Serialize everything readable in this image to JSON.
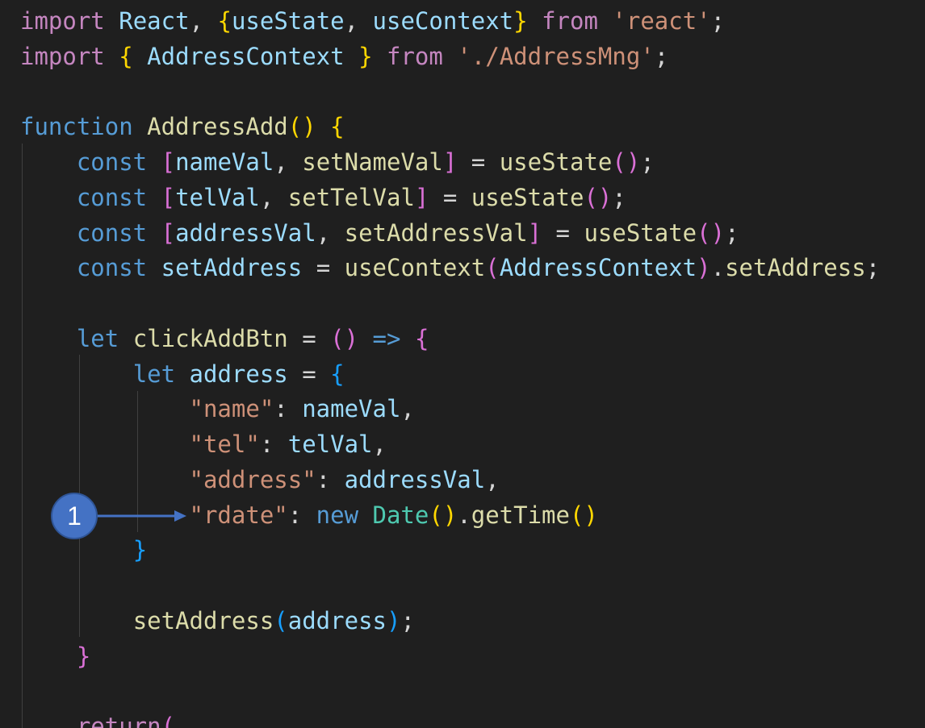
{
  "editor": {
    "background": "#1f1f1f",
    "lines": [
      [
        [
          "kw",
          "import"
        ],
        [
          "p",
          " "
        ],
        [
          "var",
          "React"
        ],
        [
          "p",
          ", "
        ],
        [
          "b1",
          "{"
        ],
        [
          "var",
          "useState"
        ],
        [
          "p",
          ", "
        ],
        [
          "var",
          "useContext"
        ],
        [
          "b1",
          "}"
        ],
        [
          "p",
          " "
        ],
        [
          "kw",
          "from"
        ],
        [
          "p",
          " "
        ],
        [
          "str",
          "'react'"
        ],
        [
          "p",
          ";"
        ]
      ],
      [
        [
          "kw",
          "import"
        ],
        [
          "p",
          " "
        ],
        [
          "b1",
          "{"
        ],
        [
          "p",
          " "
        ],
        [
          "var",
          "AddressContext"
        ],
        [
          "p",
          " "
        ],
        [
          "b1",
          "}"
        ],
        [
          "p",
          " "
        ],
        [
          "kw",
          "from"
        ],
        [
          "p",
          " "
        ],
        [
          "str",
          "'./AddressMng'"
        ],
        [
          "p",
          ";"
        ]
      ],
      [],
      [
        [
          "st",
          "function"
        ],
        [
          "p",
          " "
        ],
        [
          "fn",
          "AddressAdd"
        ],
        [
          "b1",
          "()"
        ],
        [
          "p",
          " "
        ],
        [
          "b1",
          "{"
        ]
      ],
      [
        [
          "p",
          "    "
        ],
        [
          "st",
          "const"
        ],
        [
          "p",
          " "
        ],
        [
          "b2",
          "["
        ],
        [
          "var",
          "nameVal"
        ],
        [
          "p",
          ", "
        ],
        [
          "fn",
          "setNameVal"
        ],
        [
          "b2",
          "]"
        ],
        [
          "p",
          " = "
        ],
        [
          "fn",
          "useState"
        ],
        [
          "b2",
          "()"
        ],
        [
          "p",
          ";"
        ]
      ],
      [
        [
          "p",
          "    "
        ],
        [
          "st",
          "const"
        ],
        [
          "p",
          " "
        ],
        [
          "b2",
          "["
        ],
        [
          "var",
          "telVal"
        ],
        [
          "p",
          ", "
        ],
        [
          "fn",
          "setTelVal"
        ],
        [
          "b2",
          "]"
        ],
        [
          "p",
          " = "
        ],
        [
          "fn",
          "useState"
        ],
        [
          "b2",
          "()"
        ],
        [
          "p",
          ";"
        ]
      ],
      [
        [
          "p",
          "    "
        ],
        [
          "st",
          "const"
        ],
        [
          "p",
          " "
        ],
        [
          "b2",
          "["
        ],
        [
          "var",
          "addressVal"
        ],
        [
          "p",
          ", "
        ],
        [
          "fn",
          "setAddressVal"
        ],
        [
          "b2",
          "]"
        ],
        [
          "p",
          " = "
        ],
        [
          "fn",
          "useState"
        ],
        [
          "b2",
          "()"
        ],
        [
          "p",
          ";"
        ]
      ],
      [
        [
          "p",
          "    "
        ],
        [
          "st",
          "const"
        ],
        [
          "p",
          " "
        ],
        [
          "var",
          "setAddress"
        ],
        [
          "p",
          " = "
        ],
        [
          "fn",
          "useContext"
        ],
        [
          "b2",
          "("
        ],
        [
          "var",
          "AddressContext"
        ],
        [
          "b2",
          ")"
        ],
        [
          "p",
          "."
        ],
        [
          "fn",
          "setAddress"
        ],
        [
          "p",
          ";"
        ]
      ],
      [],
      [
        [
          "p",
          "    "
        ],
        [
          "st",
          "let"
        ],
        [
          "p",
          " "
        ],
        [
          "fn",
          "clickAddBtn"
        ],
        [
          "p",
          " = "
        ],
        [
          "b2",
          "()"
        ],
        [
          "p",
          " "
        ],
        [
          "st",
          "=>"
        ],
        [
          "p",
          " "
        ],
        [
          "b2",
          "{"
        ]
      ],
      [
        [
          "p",
          "        "
        ],
        [
          "st",
          "let"
        ],
        [
          "p",
          " "
        ],
        [
          "var",
          "address"
        ],
        [
          "p",
          " = "
        ],
        [
          "b3",
          "{"
        ]
      ],
      [
        [
          "p",
          "            "
        ],
        [
          "str",
          "\"name\""
        ],
        [
          "p",
          ": "
        ],
        [
          "var",
          "nameVal"
        ],
        [
          "p",
          ","
        ]
      ],
      [
        [
          "p",
          "            "
        ],
        [
          "str",
          "\"tel\""
        ],
        [
          "p",
          ": "
        ],
        [
          "var",
          "telVal"
        ],
        [
          "p",
          ","
        ]
      ],
      [
        [
          "p",
          "            "
        ],
        [
          "str",
          "\"address\""
        ],
        [
          "p",
          ": "
        ],
        [
          "var",
          "addressVal"
        ],
        [
          "p",
          ","
        ]
      ],
      [
        [
          "p",
          "            "
        ],
        [
          "str",
          "\"rdate\""
        ],
        [
          "p",
          ": "
        ],
        [
          "st",
          "new"
        ],
        [
          "p",
          " "
        ],
        [
          "tp",
          "Date"
        ],
        [
          "b1",
          "()"
        ],
        [
          "p",
          "."
        ],
        [
          "fn",
          "getTime"
        ],
        [
          "b1",
          "()"
        ]
      ],
      [
        [
          "p",
          "        "
        ],
        [
          "b3",
          "}"
        ]
      ],
      [],
      [
        [
          "p",
          "        "
        ],
        [
          "fn",
          "setAddress"
        ],
        [
          "b3",
          "("
        ],
        [
          "var",
          "address"
        ],
        [
          "b3",
          ")"
        ],
        [
          "p",
          ";"
        ]
      ],
      [
        [
          "p",
          "    "
        ],
        [
          "b2",
          "}"
        ]
      ],
      [],
      [
        [
          "p",
          "    "
        ],
        [
          "kw",
          "return"
        ],
        [
          "b2",
          "("
        ]
      ]
    ]
  },
  "annotation": {
    "number": "1",
    "color": "#4472c4"
  }
}
